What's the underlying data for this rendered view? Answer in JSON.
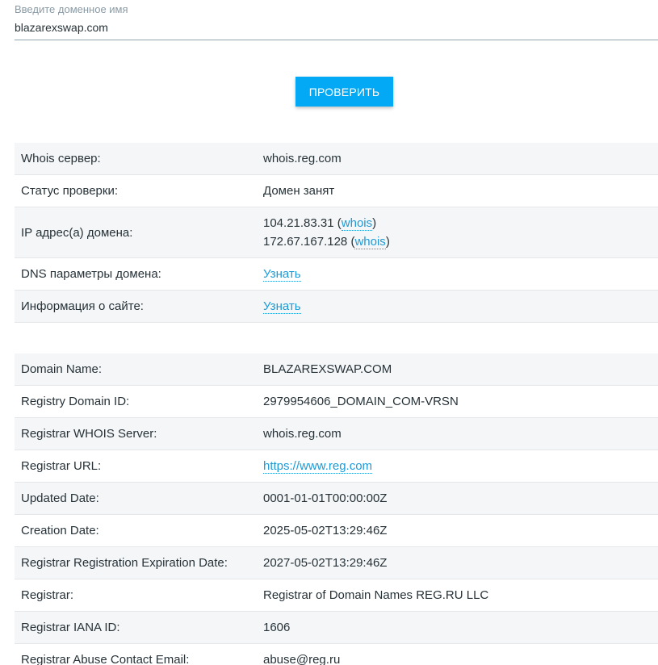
{
  "form": {
    "label": "Введите доменное имя",
    "value": "blazarexswap.com",
    "button_label": "ПРОВЕРИТЬ"
  },
  "status": {
    "whois_server_label": "Whois сервер:",
    "whois_server_value": "whois.reg.com",
    "check_status_label": "Статус проверки:",
    "check_status_value": "Домен занят",
    "ip_label": "IP адрес(а) домена:",
    "ips": [
      {
        "ip": "104.21.83.31",
        "link": "whois"
      },
      {
        "ip": "172.67.167.128",
        "link": "whois"
      }
    ],
    "dns_label": "DNS параметры домена:",
    "dns_link": "Узнать",
    "site_info_label": "Информация о сайте:",
    "site_info_link": "Узнать"
  },
  "whois": [
    {
      "key": "Domain Name:",
      "value": "BLAZAREXSWAP.COM"
    },
    {
      "key": "Registry Domain ID:",
      "value": "2979954606_DOMAIN_COM-VRSN"
    },
    {
      "key": "Registrar WHOIS Server:",
      "value": "whois.reg.com"
    },
    {
      "key": "Registrar URL:",
      "value": "https://www.reg.com"
    },
    {
      "key": "Updated Date:",
      "value": "0001-01-01T00:00:00Z"
    },
    {
      "key": "Creation Date:",
      "value": "2025-05-02T13:29:46Z"
    },
    {
      "key": "Registrar Registration Expiration Date:",
      "value": "2027-05-02T13:29:46Z"
    },
    {
      "key": "Registrar:",
      "value": "Registrar of Domain Names REG.RU LLC"
    },
    {
      "key": "Registrar IANA ID:",
      "value": "1606"
    },
    {
      "key": "Registrar Abuse Contact Email:",
      "value": "abuse@reg.ru"
    }
  ],
  "colors": {
    "accent": "#03a9f4",
    "link": "#1e9ad6",
    "row_stripe": "#f5f6f7"
  }
}
